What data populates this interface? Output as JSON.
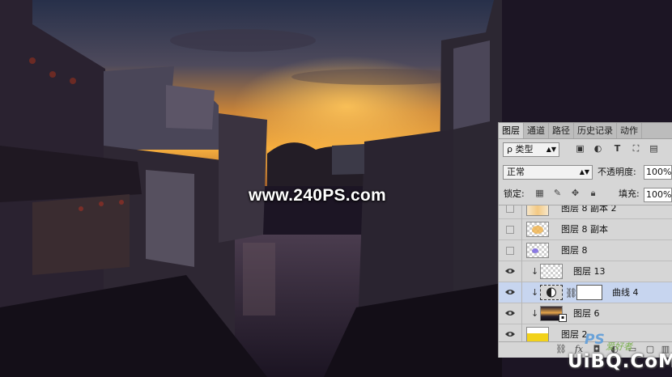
{
  "watermark": "www.240PS.com",
  "panel": {
    "tabs": [
      {
        "label": "图层",
        "active": true
      },
      {
        "label": "通道",
        "active": false
      },
      {
        "label": "路径",
        "active": false
      },
      {
        "label": "历史记录",
        "active": false
      },
      {
        "label": "动作",
        "active": false
      }
    ],
    "filter": {
      "label": "ρ 类型",
      "icons": [
        "image-filter-icon",
        "adjustment-filter-icon",
        "text-filter-icon",
        "shape-filter-icon",
        "smart-object-filter-icon"
      ]
    },
    "blend_mode": "正常",
    "opacity_label": "不透明度:",
    "opacity_value": "100%",
    "lock_label": "锁定:",
    "fill_label": "填充:",
    "fill_value": "100%",
    "layers": [
      {
        "name": "图层 8 副本 2",
        "visible": false,
        "thumb": "orange-blur",
        "clipped": false,
        "selected": false
      },
      {
        "name": "图层 8 副本",
        "visible": false,
        "thumb": "orange-blur",
        "clipped": false,
        "selected": false
      },
      {
        "name": "图层 8",
        "visible": false,
        "thumb": "purple-dot",
        "clipped": false,
        "selected": false
      },
      {
        "name": "图层 13",
        "visible": true,
        "thumb": "transparent",
        "clipped": true,
        "selected": false
      },
      {
        "name": "曲线 4",
        "visible": true,
        "thumb": "curves-adjustment",
        "clipped": true,
        "selected": true
      },
      {
        "name": "图层 6",
        "visible": true,
        "thumb": "photo",
        "clipped": true,
        "selected": false
      },
      {
        "name": "图层 2",
        "visible": true,
        "thumb": "yellow",
        "clipped": false,
        "selected": false
      }
    ]
  },
  "logo": {
    "text": "UiBQ.CoM",
    "tag": "PS",
    "tag2": "爱好者"
  },
  "colors": {
    "sky_top": "#1d2437",
    "sunset": "#f2a43a",
    "shadow": "#1c1524",
    "panel_bg": "#d6d6d6",
    "selected_row": "#c7d5ef"
  }
}
